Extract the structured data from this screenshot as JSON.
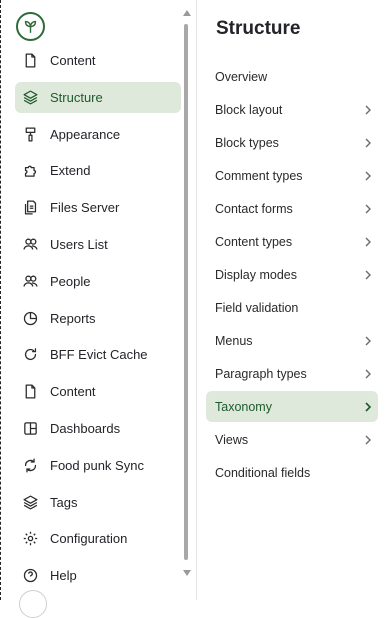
{
  "sidebar": {
    "items": [
      {
        "label": "Content",
        "icon": "document-icon"
      },
      {
        "label": "Structure",
        "icon": "layers-icon",
        "active": true
      },
      {
        "label": "Appearance",
        "icon": "paint-roller-icon"
      },
      {
        "label": "Extend",
        "icon": "puzzle-icon"
      },
      {
        "label": "Files Server",
        "icon": "files-icon"
      },
      {
        "label": "Users List",
        "icon": "users-icon"
      },
      {
        "label": "People",
        "icon": "people-icon"
      },
      {
        "label": "Reports",
        "icon": "pie-chart-icon"
      },
      {
        "label": "BFF Evict Cache",
        "icon": "refresh-icon"
      },
      {
        "label": "Content",
        "icon": "document-icon"
      },
      {
        "label": "Dashboards",
        "icon": "dashboard-icon"
      },
      {
        "label": "Food punk Sync",
        "icon": "sync-icon"
      },
      {
        "label": "Tags",
        "icon": "tags-icon"
      },
      {
        "label": "Configuration",
        "icon": "gear-icon"
      },
      {
        "label": "Help",
        "icon": "help-icon"
      }
    ]
  },
  "panel": {
    "title": "Structure",
    "items": [
      {
        "label": "Overview",
        "has_children": false
      },
      {
        "label": "Block layout",
        "has_children": true
      },
      {
        "label": "Block types",
        "has_children": true
      },
      {
        "label": "Comment types",
        "has_children": true
      },
      {
        "label": "Contact forms",
        "has_children": true
      },
      {
        "label": "Content types",
        "has_children": true
      },
      {
        "label": "Display modes",
        "has_children": true
      },
      {
        "label": "Field validation",
        "has_children": false
      },
      {
        "label": "Menus",
        "has_children": true
      },
      {
        "label": "Paragraph types",
        "has_children": true
      },
      {
        "label": "Taxonomy",
        "has_children": true,
        "active": true
      },
      {
        "label": "Views",
        "has_children": true
      },
      {
        "label": "Conditional fields",
        "has_children": false
      }
    ]
  },
  "colors": {
    "accent": "#1d5b2c",
    "active_bg": "#dfe9db",
    "text": "#232429"
  }
}
